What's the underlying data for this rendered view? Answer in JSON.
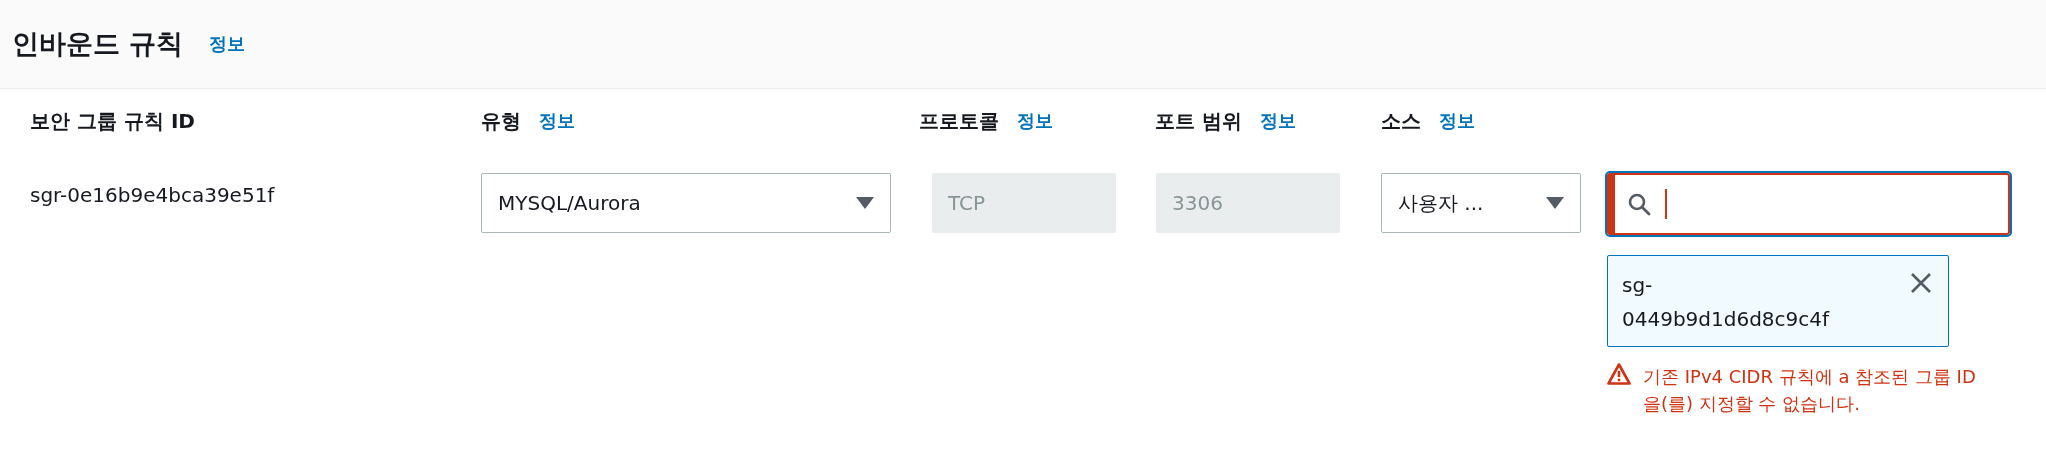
{
  "section": {
    "title": "인바운드 규칙",
    "info": "정보"
  },
  "columns": [
    {
      "label": "보안 그룹 규칙 ID"
    },
    {
      "label": "유형",
      "info": "정보"
    },
    {
      "label": "프로토콜",
      "info": "정보"
    },
    {
      "label": "포트 범위",
      "info": "정보"
    },
    {
      "label": "소스",
      "info": "정보"
    }
  ],
  "rule": {
    "id": "sgr-0e16b9e4bca39e51f",
    "type": "MYSQL/Aurora",
    "protocol": "TCP",
    "port_range": "3306",
    "source": "사용자 ...",
    "search": {
      "invalid": true
    },
    "tokens": [
      {
        "label": "sg-0449b9d1d6d8c9c4f"
      }
    ],
    "error": "기존 IPv4 CIDR 규칙에 a 참조된 그룹 ID을(를) 지정할 수 없습니다."
  }
}
